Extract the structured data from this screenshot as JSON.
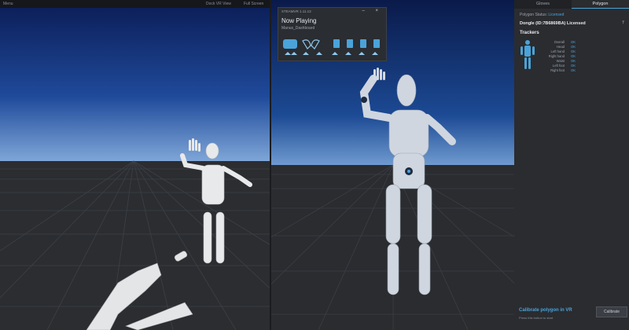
{
  "left_viewport": {
    "menu_label": "Menu",
    "dock_label": "Dock VR View",
    "fullscreen_label": "Full Screen"
  },
  "steamvr_popup": {
    "header": "STEAMVR 1.11.13",
    "title": "Now Playing",
    "subtitle": "Manus_Dashboard",
    "controls": "– ×",
    "dock_icons": [
      "gloves-icon",
      "left-hand-icon",
      "right-hand-icon",
      "tracker-icon",
      "tracker-icon",
      "tracker-icon",
      "tracker-icon"
    ]
  },
  "side_panel": {
    "tabs": [
      {
        "label": "Gloves",
        "active": false
      },
      {
        "label": "Polygon",
        "active": true
      }
    ],
    "status_prefix": "Polygon Status:",
    "status_value": "Licensed",
    "dongle": "Dongle (ID:7B6869BA) Licensed",
    "trackers_title": "Trackers",
    "trackers": [
      {
        "name": "Overall",
        "status": "OK"
      },
      {
        "name": "Head",
        "status": "OK"
      },
      {
        "name": "Left hand",
        "status": "OK"
      },
      {
        "name": "Right hand",
        "status": "OK"
      },
      {
        "name": "Waist",
        "status": "OK"
      },
      {
        "name": "Left foot",
        "status": "OK"
      },
      {
        "name": "Right foot",
        "status": "OK"
      }
    ],
    "calibrate_title": "Calibrate polygon in VR",
    "calibrate_hint": "Press this button to start",
    "calibrate_button": "Calibrate"
  },
  "colors": {
    "accent": "#4aa3d9",
    "panel_bg": "#2a2c30",
    "sky_top": "#0f2a6a",
    "floor": "#2b2d31"
  }
}
